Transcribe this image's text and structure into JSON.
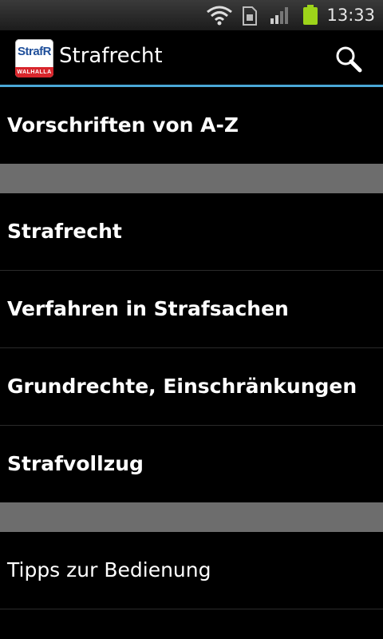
{
  "status_bar": {
    "time": "13:33",
    "icons": [
      "wifi-icon",
      "sim-card-icon",
      "signal-icon",
      "battery-icon"
    ],
    "battery_color": "#9dd41a"
  },
  "action_bar": {
    "logo_text": "StrafR",
    "logo_band_text": "WALHALLA",
    "title": "Strafrecht",
    "search_icon": "search-icon",
    "accent_color": "#4aa7d6"
  },
  "list": {
    "top_item": "Vorschriften von A-Z",
    "categories": [
      "Strafrecht",
      "Verfahren in Strafsachen",
      "Grundrechte, Einschränkungen",
      "Strafvollzug"
    ],
    "help_item": "Tipps zur Bedienung"
  }
}
